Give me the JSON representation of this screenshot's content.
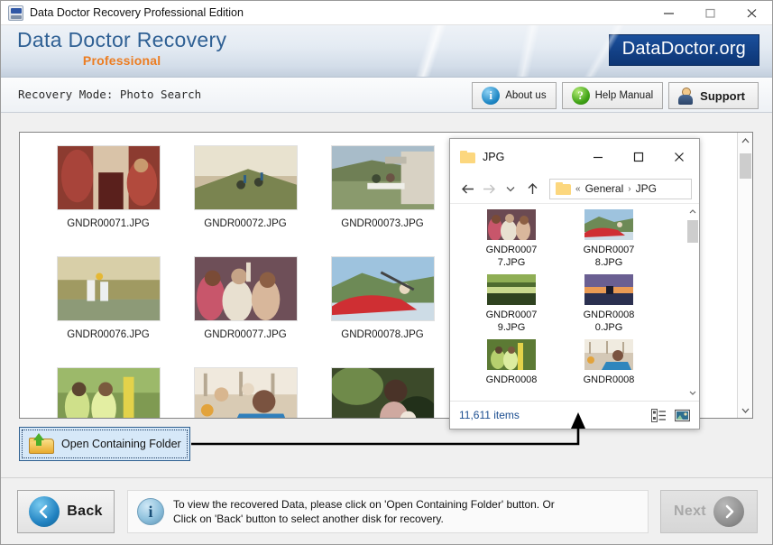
{
  "window": {
    "title": "Data Doctor Recovery Professional Edition",
    "icon": "app-icon",
    "controls": {
      "minimize": "—",
      "maximize": "□",
      "close": "✕"
    }
  },
  "brand": {
    "title": "Data Doctor Recovery",
    "subtitle": "Professional",
    "badge": "DataDoctor.org",
    "title_color": "#2f6094",
    "subtitle_color": "#ec7d22",
    "badge_color": "#11407f"
  },
  "modebar": {
    "mode_label": "Recovery Mode: Photo Search",
    "buttons": [
      {
        "label": "About us",
        "icon": "info-icon"
      },
      {
        "label": "Help Manual",
        "icon": "question-icon"
      },
      {
        "label": "Support",
        "icon": "person-icon"
      }
    ]
  },
  "thumbnails": {
    "rows": [
      [
        {
          "name": "GNDR00071.JPG",
          "colors": [
            "#8c3b30",
            "#d9c3a8",
            "#5a201c"
          ]
        },
        {
          "name": "GNDR00072.JPG",
          "colors": [
            "#cbbda0",
            "#e8e2cf",
            "#7a8450"
          ]
        },
        {
          "name": "GNDR00073.JPG",
          "colors": [
            "#8a9a6d",
            "#d8d2c4",
            "#6f7f55"
          ]
        }
      ],
      [
        {
          "name": "GNDR00076.JPG",
          "colors": [
            "#b8a97f",
            "#d8cfa8",
            "#6d7a4e"
          ]
        },
        {
          "name": "GNDR00077.JPG",
          "colors": [
            "#6e4f58",
            "#d8b79b",
            "#3d2b33"
          ]
        },
        {
          "name": "GNDR00078.JPG",
          "colors": [
            "#9ec3de",
            "#cf2f33",
            "#6d8a56"
          ]
        }
      ],
      [
        {
          "name": "",
          "colors": [
            "#7f9a52",
            "#cfe08a",
            "#4c6a2e"
          ]
        },
        {
          "name": "",
          "colors": [
            "#d9cbb4",
            "#f0e9dd",
            "#2f7fbc"
          ]
        },
        {
          "name": "",
          "colors": [
            "#3c4a2a",
            "#6f8a4a",
            "#22301a"
          ]
        }
      ]
    ],
    "scrollbar": {
      "up": "⌃",
      "down": "⌄"
    }
  },
  "open_folder_button": {
    "label": "Open Containing Folder",
    "icon": "folder-up-icon",
    "focused": true
  },
  "explorer": {
    "title": "JPG",
    "title_icon": "folder-icon",
    "controls": {
      "minimize": "—",
      "maximize": "□",
      "close": "✕"
    },
    "nav": {
      "back": "←",
      "forward": "→",
      "recent": "⌄",
      "up": "↑"
    },
    "address": {
      "icon": "folder-icon",
      "crumbs": [
        "«",
        "General",
        "›",
        "JPG"
      ]
    },
    "files": [
      {
        "line1": "GNDR0007",
        "line2": "7.JPG",
        "colors": [
          "#6b4a52",
          "#d9b79c",
          "#3f2c34"
        ]
      },
      {
        "line1": "GNDR0007",
        "line2": "8.JPG",
        "colors": [
          "#9ec3de",
          "#cf2f33",
          "#6d8a56"
        ]
      },
      {
        "line1": "GNDR0007",
        "line2": "9.JPG",
        "colors": [
          "#4e6b30",
          "#8fae55",
          "#2f4320"
        ]
      },
      {
        "line1": "GNDR0008",
        "line2": "0.JPG",
        "colors": [
          "#4a4f7a",
          "#e99a54",
          "#2b3050"
        ]
      },
      {
        "line1": "GNDR0008",
        "line2": "",
        "colors": [
          "#5c7a34",
          "#b6cf6e",
          "#35481f"
        ]
      },
      {
        "line1": "GNDR0008",
        "line2": "",
        "colors": [
          "#d4c8b6",
          "#f0ebe0",
          "#2f86bd"
        ]
      }
    ],
    "status": {
      "count": "11,611 items",
      "count_color": "#1d4f91"
    },
    "view_buttons": [
      {
        "icon": "details-view-icon"
      },
      {
        "icon": "large-icons-view-icon"
      }
    ],
    "scrollbar": {
      "up": "⌃",
      "down": "⌄"
    }
  },
  "footer": {
    "back": {
      "label": "Back",
      "icon": "chevron-left-icon"
    },
    "next": {
      "label": "Next",
      "icon": "chevron-right-icon",
      "disabled": true
    },
    "info": {
      "icon": "info-icon",
      "line1": "To view the recovered Data, please click on 'Open Containing Folder' button. Or",
      "line2": "Click on 'Back' button to select another disk for recovery."
    }
  }
}
